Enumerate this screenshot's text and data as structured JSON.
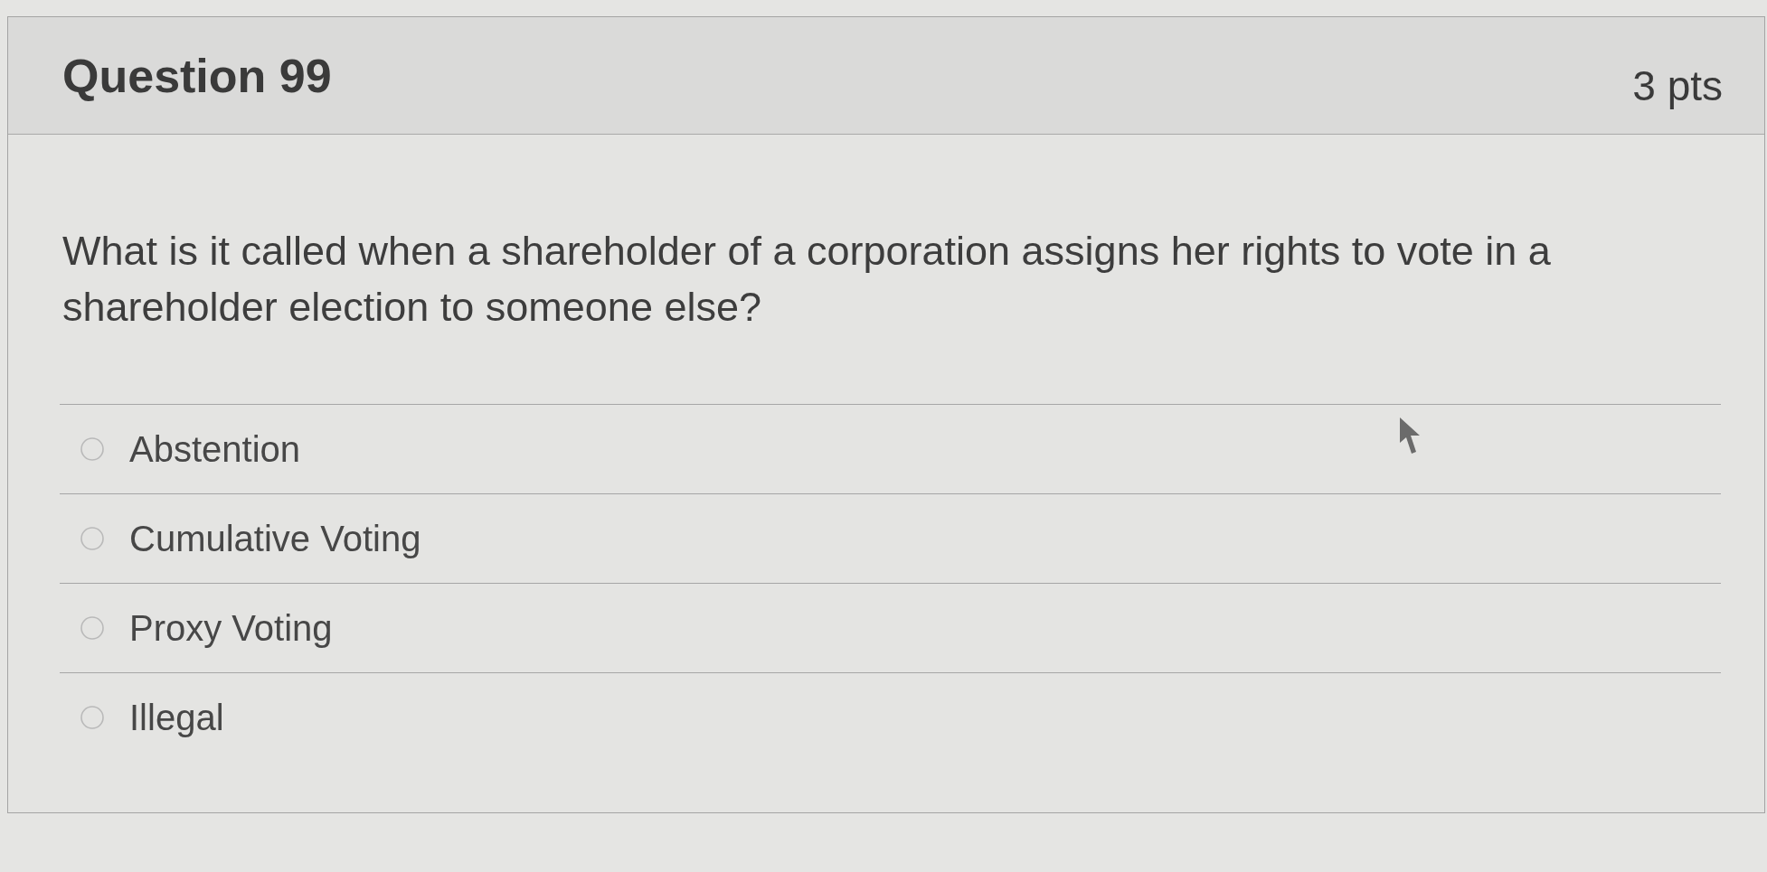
{
  "question": {
    "title": "Question 99",
    "points": "3 pts",
    "text": "What is it called when a shareholder of a corporation assigns her rights to vote in a shareholder election to someone else?"
  },
  "answers": [
    {
      "label": "Abstention",
      "selected": false
    },
    {
      "label": "Cumulative Voting",
      "selected": false
    },
    {
      "label": "Proxy Voting",
      "selected": false
    },
    {
      "label": "Illegal",
      "selected": false
    }
  ]
}
